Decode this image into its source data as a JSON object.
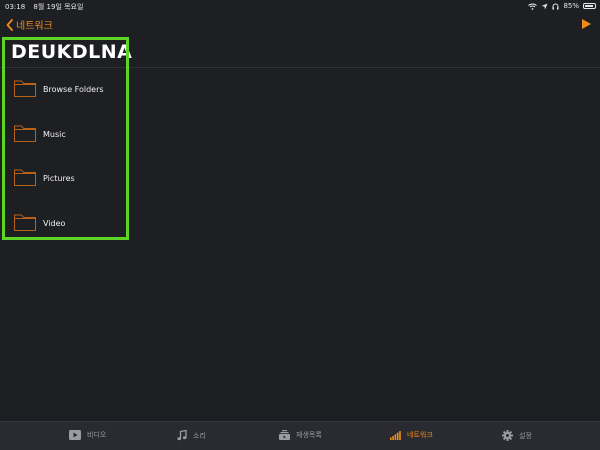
{
  "status": {
    "time": "03:18",
    "date": "8월 19일 목요일",
    "battery": "85%",
    "battery_level": 0.85
  },
  "nav": {
    "back_label": "네트워크",
    "play_icon": "play-icon"
  },
  "server": {
    "title": "DEUKDLNA"
  },
  "items": [
    {
      "label": "Browse Folders",
      "icon": "folder-icon"
    },
    {
      "label": "Music",
      "icon": "folder-icon"
    },
    {
      "label": "Pictures",
      "icon": "folder-icon"
    },
    {
      "label": "Video",
      "icon": "folder-icon"
    }
  ],
  "tabs": [
    {
      "label": "비디오",
      "icon": "video-icon",
      "active": false
    },
    {
      "label": "소리",
      "icon": "music-note-icon",
      "active": false
    },
    {
      "label": "재생목록",
      "icon": "playlist-icon",
      "active": false
    },
    {
      "label": "네트워크",
      "icon": "network-icon",
      "active": true
    },
    {
      "label": "설정",
      "icon": "gear-icon",
      "active": false
    }
  ],
  "colors": {
    "accent": "#f08c1a",
    "background": "#1e1f23",
    "highlight": "#5ed426",
    "tab_inactive": "#9b9ca1"
  }
}
